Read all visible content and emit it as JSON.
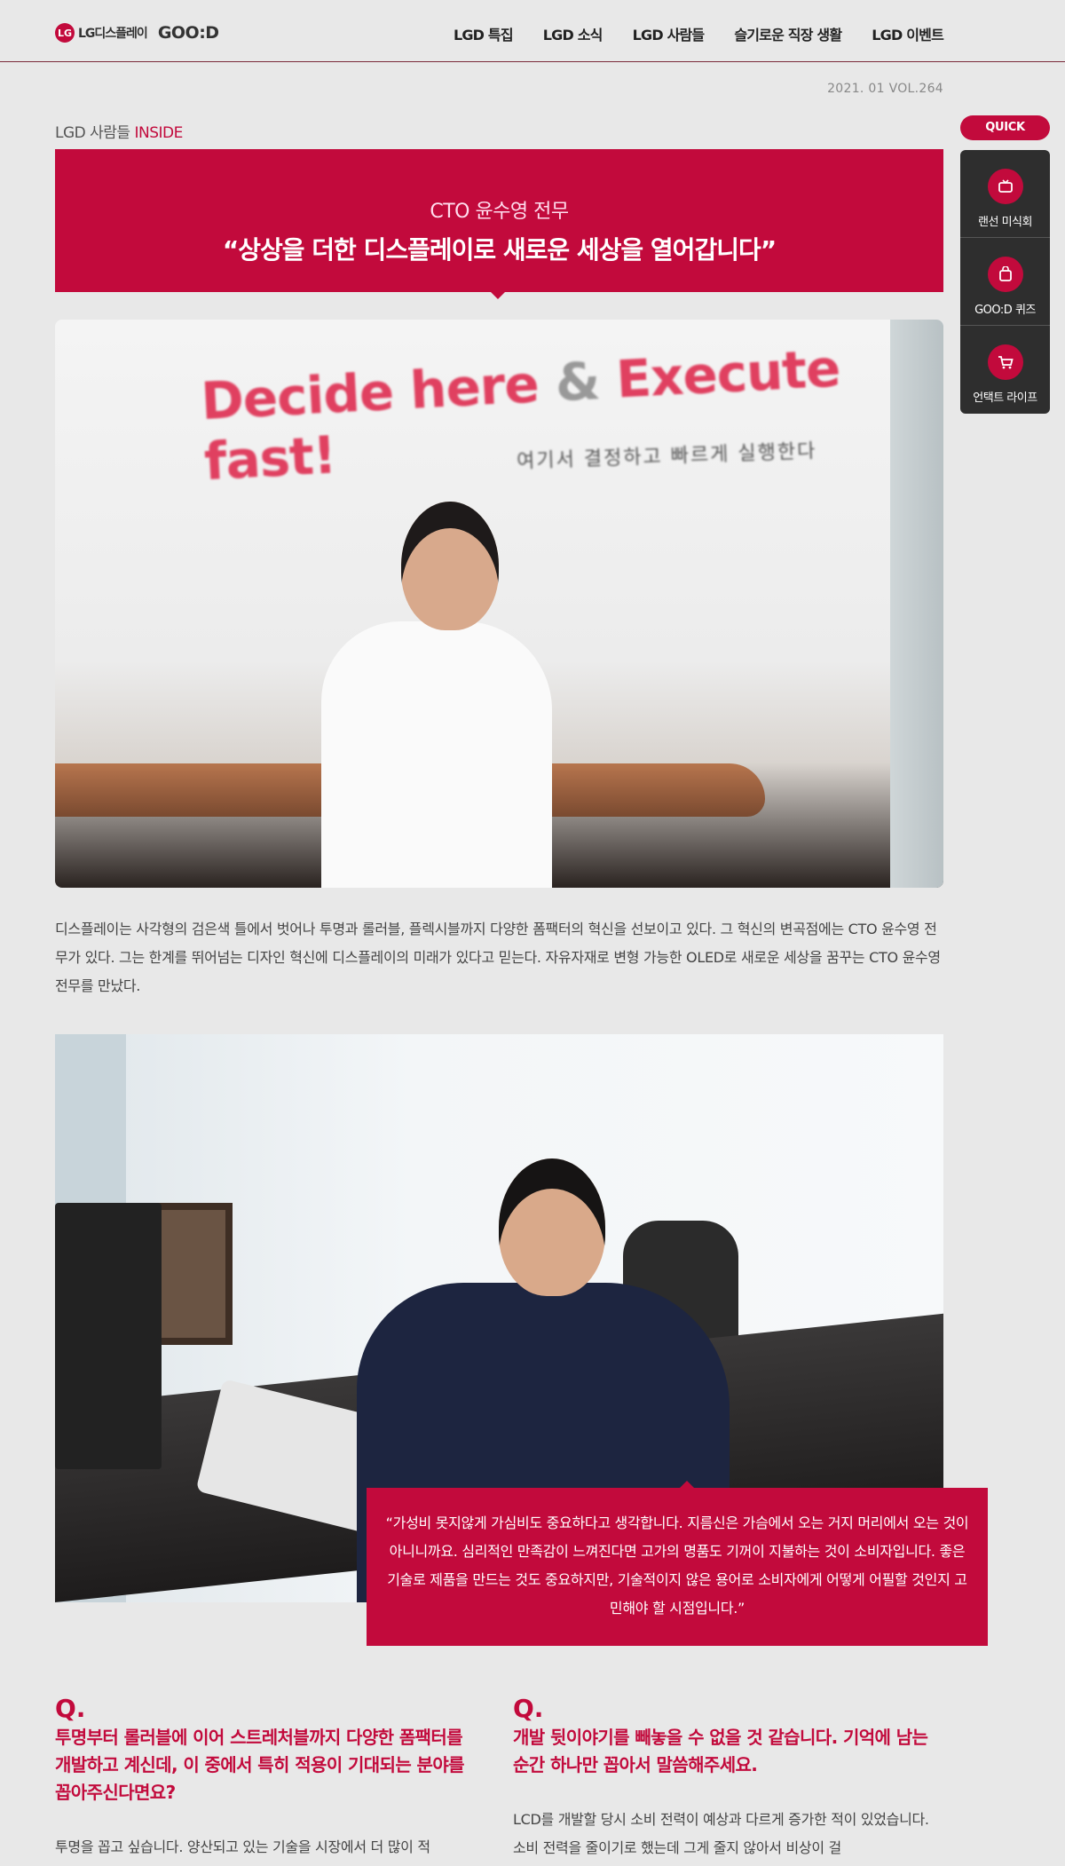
{
  "header": {
    "logo_text": "LG디스플레이",
    "logo_brand": "GOO:D",
    "nav": [
      "LGD 특집",
      "LGD 소식",
      "LGD 사람들",
      "슬기로운 직장 생활",
      "LGD 이벤트"
    ]
  },
  "issue": "2021. 01 VOL.264",
  "breadcrumb": {
    "section": "LGD 사람들",
    "sub": "INSIDE"
  },
  "title": {
    "role": "CTO 윤수영 전무",
    "headline": "“상상을 더한 디스플레이로 새로운 세상을 열어갑니다”"
  },
  "photo1": {
    "slogan_red1": "Decide here",
    "slogan_amp": "&",
    "slogan_red2": "Execute fast!",
    "slogan_sub": "여기서 결정하고 빠르게 실행한다"
  },
  "intro": "디스플레이는 사각형의 검은색 틀에서 벗어나 투명과 롤러블, 플렉시블까지 다양한 폼팩터의 혁신을 선보이고 있다. 그 혁신의 변곡점에는 CTO 윤수영 전무가 있다. 그는 한계를 뛰어넘는 디자인 혁신에 디스플레이의 미래가 있다고 믿는다. 자유자재로 변형 가능한 OLED로 새로운 세상을 꿈꾸는 CTO 윤수영 전무를 만났다.",
  "quote": "“가성비 못지않게 가심비도 중요하다고 생각합니다. 지름신은 가슴에서 오는 거지 머리에서 오는 것이 아니니까요. 심리적인 만족감이 느껴진다면 고가의 명품도 기꺼이 지불하는 것이 소비자입니다. 좋은 기술로 제품을 만드는 것도 중요하지만, 기술적이지 않은 용어로 소비자에게 어떻게 어필할 것인지 고민해야 할 시점입니다.”",
  "qa": [
    {
      "q": "Q.",
      "question": "투명부터 롤러블에 이어 스트레처블까지 다양한 폼팩터를 개발하고 계신데, 이 중에서 특히 적용이 기대되는 분야를 꼽아주신다면요?",
      "answer": "투명을 꼽고 싶습니다. 양산되고 있는 기술을 시장에서 더 많이 적"
    },
    {
      "q": "Q.",
      "question": "개발 뒷이야기를 빼놓을 수 없을 것 같습니다. 기억에 남는 순간 하나만 꼽아서 말씀해주세요.",
      "answer": "LCD를 개발할 당시 소비 전력이 예상과 다르게 증가한 적이 있었습니다. 소비 전력을 줄이기로 했는데 그게 줄지 않아서 비상이 걸"
    }
  ],
  "quick": {
    "label": "QUICK",
    "items": [
      {
        "label": "랜선 미식회",
        "icon": "tv-icon"
      },
      {
        "label": "GOO:D 퀴즈",
        "icon": "bag-icon"
      },
      {
        "label": "언택트 라이프",
        "icon": "cart-icon"
      }
    ]
  },
  "colors": {
    "accent": "#c20a3c",
    "quick_panel": "#2e2e2e",
    "background": "#e8e8e8"
  }
}
